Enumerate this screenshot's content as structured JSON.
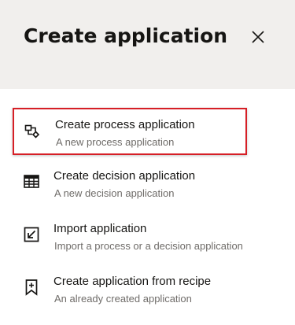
{
  "dialog": {
    "title": "Create application",
    "close_icon": "close-icon"
  },
  "menu": {
    "items": [
      {
        "label": "Create process application",
        "description": "A new process application",
        "icon": "process-flow-icon",
        "selected": true
      },
      {
        "label": "Create decision application",
        "description": "A new decision application",
        "icon": "table-icon",
        "selected": false
      },
      {
        "label": "Import application",
        "description": "Import a process or a decision application",
        "icon": "import-icon",
        "selected": false
      },
      {
        "label": "Create application from recipe",
        "description": "An already created application",
        "icon": "bookmark-add-icon",
        "selected": false
      }
    ]
  },
  "colors": {
    "header_bg": "#f1efed",
    "selection_border": "#d61f26",
    "text_primary": "#161513",
    "text_secondary": "#6f6c69"
  }
}
